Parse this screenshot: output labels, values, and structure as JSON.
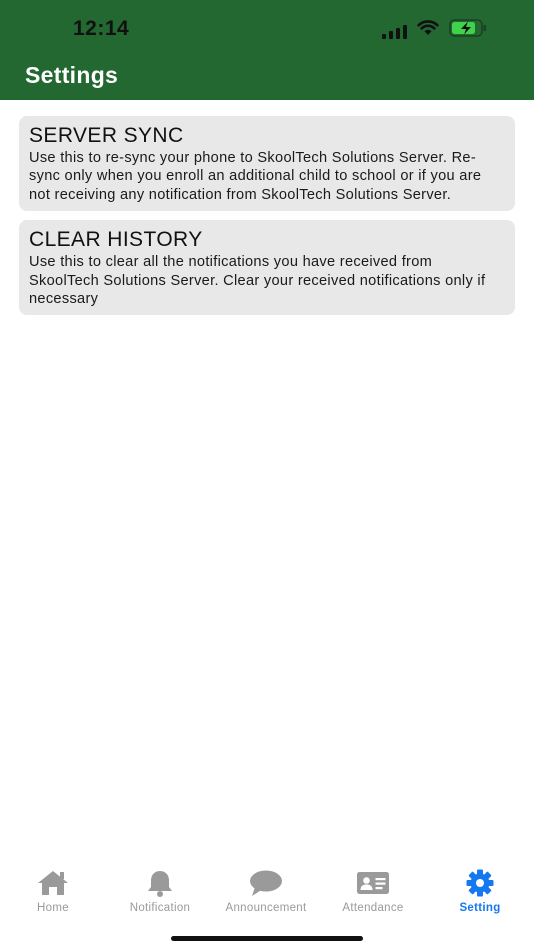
{
  "status_bar": {
    "time": "12:14"
  },
  "header": {
    "title": "Settings",
    "background_color": "#236731"
  },
  "cards": [
    {
      "title": "SERVER SYNC",
      "description": "Use this to re-sync your phone to SkoolTech Solutions Server. Re-sync only when you enroll an additional child to school or if you are not receiving any notification from SkoolTech Solutions Server."
    },
    {
      "title": "CLEAR HISTORY",
      "description": "Use this to clear all the notifications you have received from SkoolTech Solutions Server. Clear your received notifications only if necessary"
    }
  ],
  "tabbar": {
    "active_color": "#1479f0",
    "inactive_color": "#9a9a9a",
    "items": [
      {
        "label": "Home",
        "icon": "home-icon"
      },
      {
        "label": "Notification",
        "icon": "bell-icon"
      },
      {
        "label": "Announcement",
        "icon": "speech-bubble-icon"
      },
      {
        "label": "Attendance",
        "icon": "id-card-icon"
      },
      {
        "label": "Setting",
        "icon": "gear-icon",
        "active": true
      }
    ]
  }
}
